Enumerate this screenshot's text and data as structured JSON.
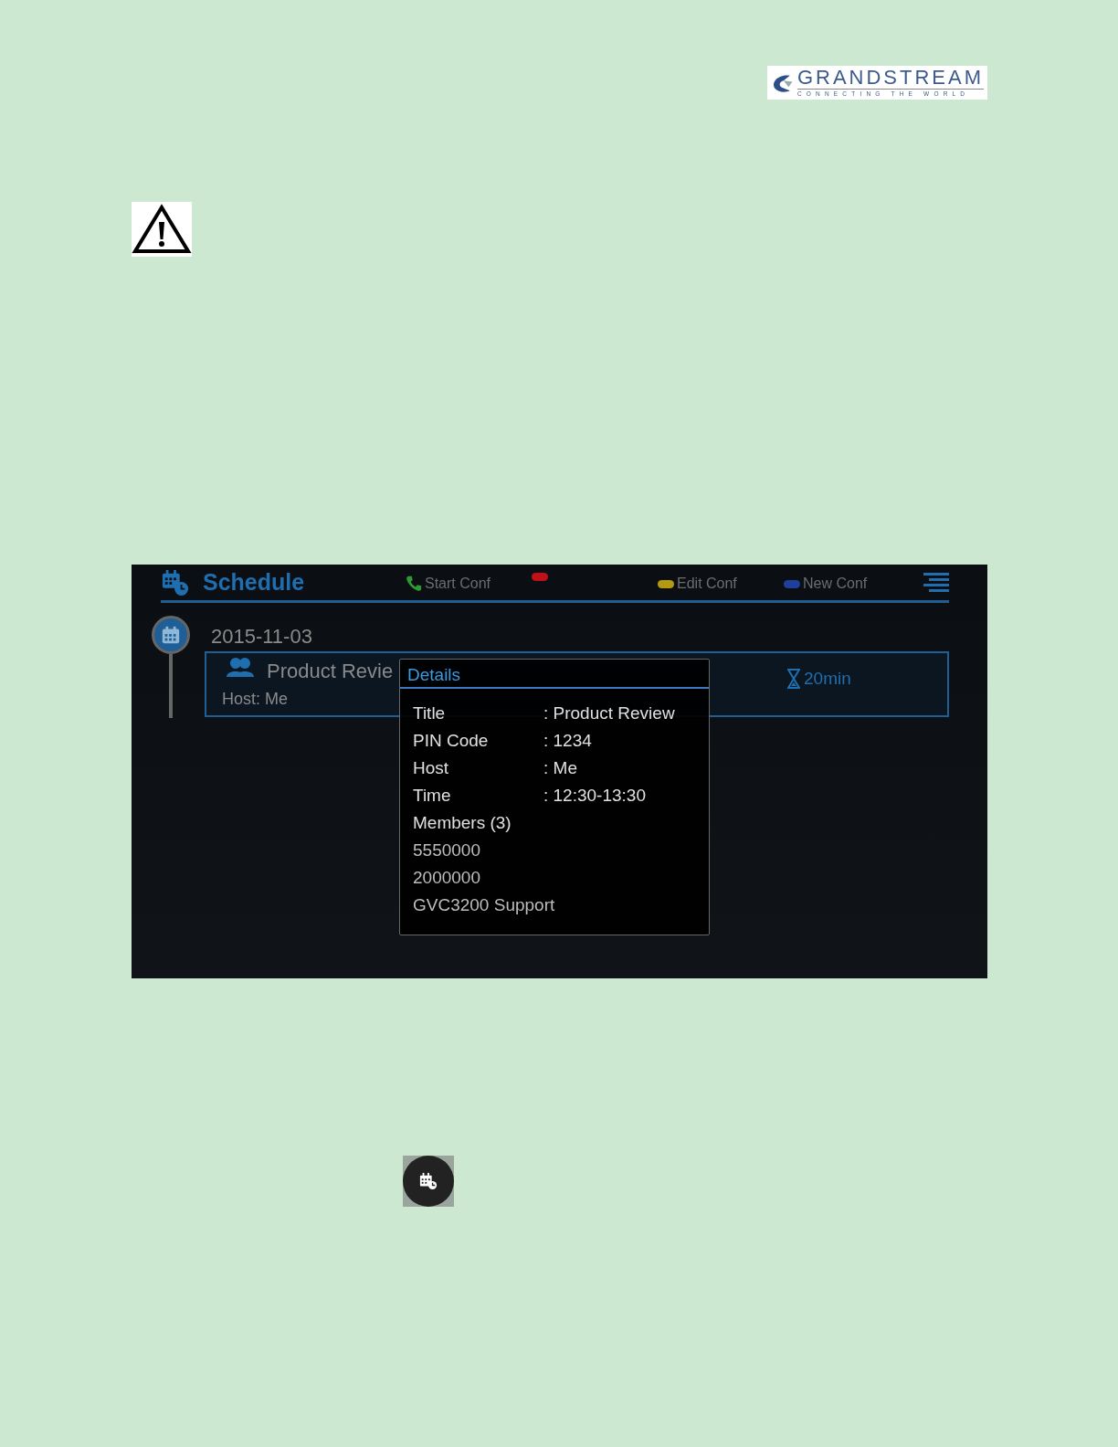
{
  "logo": {
    "name": "GRANDSTREAM",
    "tagline": "CONNECTING THE WORLD"
  },
  "screen": {
    "title": "Schedule",
    "softkeys": [
      {
        "kind": "phone",
        "label": "Start Conf"
      },
      {
        "kind": "pill",
        "color": "#c0111a"
      },
      {
        "kind": "pill",
        "color": "#b49a10",
        "label": "Edit Conf"
      },
      {
        "kind": "pill",
        "color": "#1f3f9a",
        "label": "New Conf"
      }
    ],
    "date": "2015-11-03",
    "event": {
      "title": "Product Revie",
      "host": "Host: Me",
      "duration": "20min"
    },
    "details": {
      "title": "Details",
      "fields": [
        {
          "label": "Title",
          "value": ": Product Review"
        },
        {
          "label": "PIN Code",
          "value": ": 1234"
        },
        {
          "label": "Host",
          "value": ": Me"
        },
        {
          "label": "Time",
          "value": ": 12:30-13:30"
        }
      ],
      "members_heading": "Members (3)",
      "members": [
        "5550000",
        "2000000",
        "GVC3200 Support"
      ]
    }
  }
}
